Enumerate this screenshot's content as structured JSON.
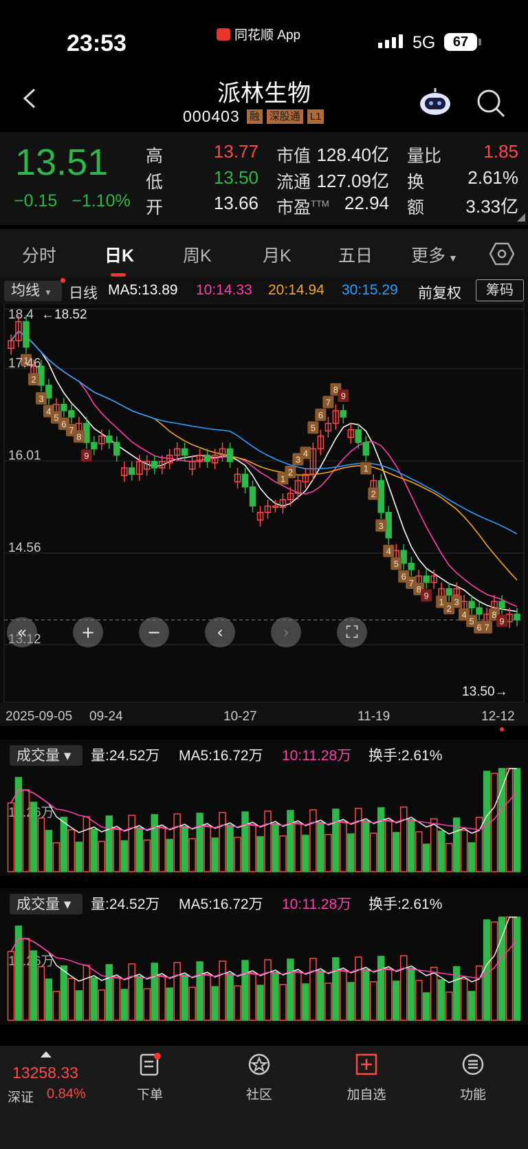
{
  "status_bar": {
    "time": "23:53",
    "app": "同花顺 App",
    "network": "5G",
    "battery": "67"
  },
  "header": {
    "title": "派林生物",
    "code": "000403",
    "tags": [
      "融",
      "深股通",
      "L1"
    ]
  },
  "quote": {
    "price": "13.51",
    "change": "−0.15",
    "change_pct": "−1.10%",
    "high_label": "高",
    "high": "13.77",
    "low_label": "低",
    "low": "13.50",
    "open_label": "开",
    "open": "13.66",
    "mktcap_label": "市值",
    "mktcap": "128.40亿",
    "float_label": "流通",
    "float": "127.09亿",
    "pe_label": "市盈",
    "pe_sup": "TTM",
    "pe": "22.94",
    "volratio_label": "量比",
    "volratio": "1.85",
    "turnover_label": "换",
    "turnover": "2.61%",
    "amount_label": "额",
    "amount": "3.33亿"
  },
  "tabs": [
    "分时",
    "日K",
    "周K",
    "月K",
    "五日",
    "更多"
  ],
  "active_tab": "日K",
  "ma_bar": {
    "select": "均线",
    "period": "日线",
    "ma5": "MA5:13.89",
    "ma10": "10:14.33",
    "ma20": "20:14.94",
    "ma30": "30:15.29",
    "adjust": "前复权",
    "chips": "筹码"
  },
  "colors": {
    "up": "#ff4a4a",
    "down": "#2eb84a",
    "ma5": "#ffffff",
    "ma10": "#ff3fb0",
    "ma20": "#f5a623",
    "ma30": "#2e9fff"
  },
  "chart_data": {
    "type": "candlestick",
    "price_axis": {
      "ticks": [
        "18.4",
        "17.46",
        "16.01",
        "14.56",
        "13.12"
      ],
      "max_label": "18.52",
      "min_label": "13.50",
      "ylim": [
        13.12,
        18.4
      ]
    },
    "date_labels": [
      "2025-09-05",
      "09-24",
      "10-27",
      "11-19",
      "12-12"
    ],
    "seq_counts": {
      "early_down": [
        "1",
        "2",
        "3",
        "4",
        "5",
        "6",
        "7",
        "8",
        "9"
      ],
      "mid_up": [
        "1",
        "2",
        "3",
        "4",
        "5",
        "6",
        "7",
        "8",
        "9"
      ],
      "late_down_a": [
        "1",
        "2",
        "3",
        "4",
        "5",
        "6",
        "7",
        "8",
        "9"
      ],
      "late_down_b": [
        "1",
        "2",
        "3",
        "4",
        "5",
        "6",
        "7",
        "8",
        "9"
      ]
    },
    "volume": {
      "label": "成交量",
      "vol": "量:24.52万",
      "ma5": "MA5:16.72万",
      "ma10": "10:11.28万",
      "turnover": "换手:2.61%",
      "axis": "12.26万"
    }
  },
  "bottom_nav": {
    "index_value": "13258.33",
    "index_name": "深证",
    "index_pct": "0.84%",
    "items": [
      "下单",
      "社区",
      "加自选",
      "功能"
    ]
  }
}
